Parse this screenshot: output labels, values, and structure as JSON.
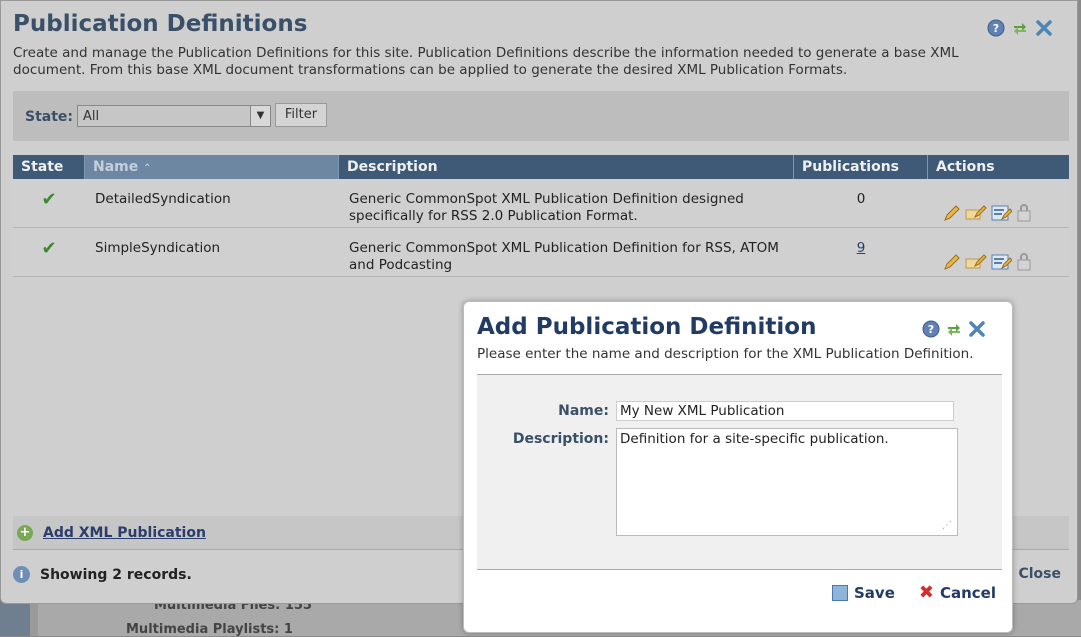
{
  "page": {
    "title": "Publication Definitions",
    "description": "Create and manage the Publication Definitions for this site. Publication Definitions describe the information needed to generate a base XML document. From this base XML document transformations can be applied to generate the desired XML Publication Formats.",
    "header_icons": [
      "help-icon",
      "refresh-icon",
      "close-icon"
    ]
  },
  "filter": {
    "label": "State:",
    "selected": "All",
    "button": "Filter"
  },
  "table": {
    "columns": [
      "State",
      "Name",
      "Description",
      "Publications",
      "Actions"
    ],
    "sort_column": "Name",
    "sort_indicator": "⌃",
    "rows": [
      {
        "state": "✔",
        "name": "DetailedSyndication",
        "description": "Generic CommonSpot XML Publication Definition designed specifically for RSS 2.0 Publication Format.",
        "publications": "0",
        "publications_link": false
      },
      {
        "state": "✔",
        "name": "SimpleSyndication",
        "description": "Generic CommonSpot XML Publication Definition for RSS, ATOM and Podcasting",
        "publications": "9",
        "publications_link": true
      }
    ],
    "action_icons": [
      "edit-pencil-icon",
      "edit-properties-icon",
      "edit-form-icon",
      "delete-lock-icon"
    ]
  },
  "footer": {
    "add_label": "Add XML Publication",
    "status": "Showing 2 records.",
    "close_label": "Close"
  },
  "background": {
    "row1": "Multimedia Files: 155",
    "row2": "Multimedia Playlists: 1"
  },
  "dialog": {
    "title": "Add Publication Definition",
    "description": "Please enter the name and description for the XML Publication Definition.",
    "name_label": "Name:",
    "name_value": "My New XML Publication",
    "desc_label": "Description:",
    "desc_value": "Definition for a site-specific publication.",
    "save_label": "Save",
    "cancel_label": "Cancel"
  },
  "colors": {
    "header_bg": "#3f5a77",
    "title_blue": "#3a5068",
    "dialog_title": "#223b63",
    "check_green": "#3d8a2c",
    "cancel_red": "#d42d2d"
  }
}
